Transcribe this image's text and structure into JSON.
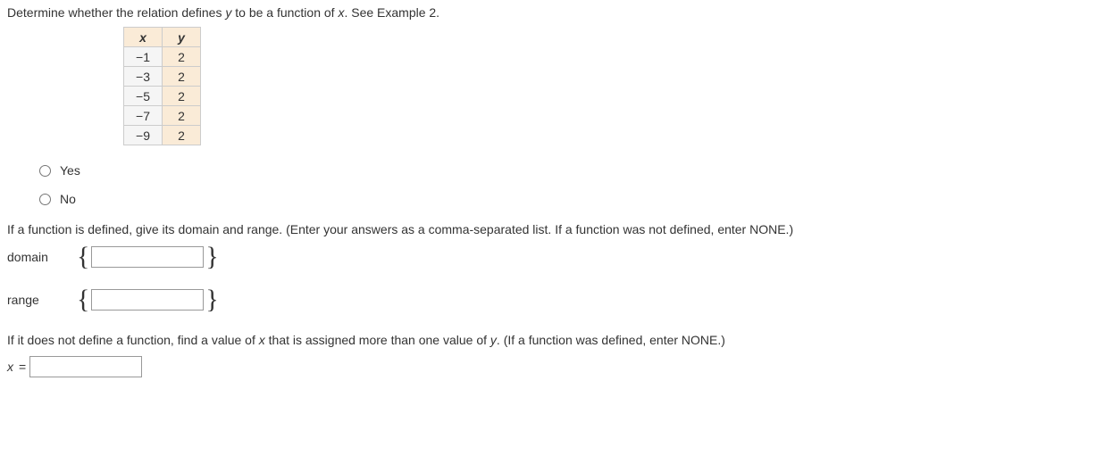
{
  "question": {
    "pre": "Determine whether the relation defines ",
    "var1": "y",
    "mid": " to be a function of ",
    "var2": "x",
    "post": ". See Example 2."
  },
  "table": {
    "headers": {
      "x": "x",
      "y": "y"
    },
    "rows": [
      {
        "x": "−1",
        "y": "2"
      },
      {
        "x": "−3",
        "y": "2"
      },
      {
        "x": "−5",
        "y": "2"
      },
      {
        "x": "−7",
        "y": "2"
      },
      {
        "x": "−9",
        "y": "2"
      }
    ]
  },
  "radios": {
    "yes": "Yes",
    "no": "No"
  },
  "instruction": "If a function is defined, give its domain and range. (Enter your answers as a comma-separated list. If a function was not defined, enter NONE.)",
  "domain_label": "domain",
  "range_label": "range",
  "braces": {
    "open": "{",
    "close": "}"
  },
  "final_instruction_pre": "If it does not define a function, find a value of ",
  "final_var1": "x",
  "final_instruction_mid": " that is assigned more than one value of ",
  "final_var2": "y",
  "final_instruction_post": ". (If a function was defined, enter NONE.)",
  "x_eq": {
    "x": "x",
    "eq": " = "
  },
  "inputs": {
    "domain_value": "",
    "range_value": "",
    "x_value": ""
  }
}
